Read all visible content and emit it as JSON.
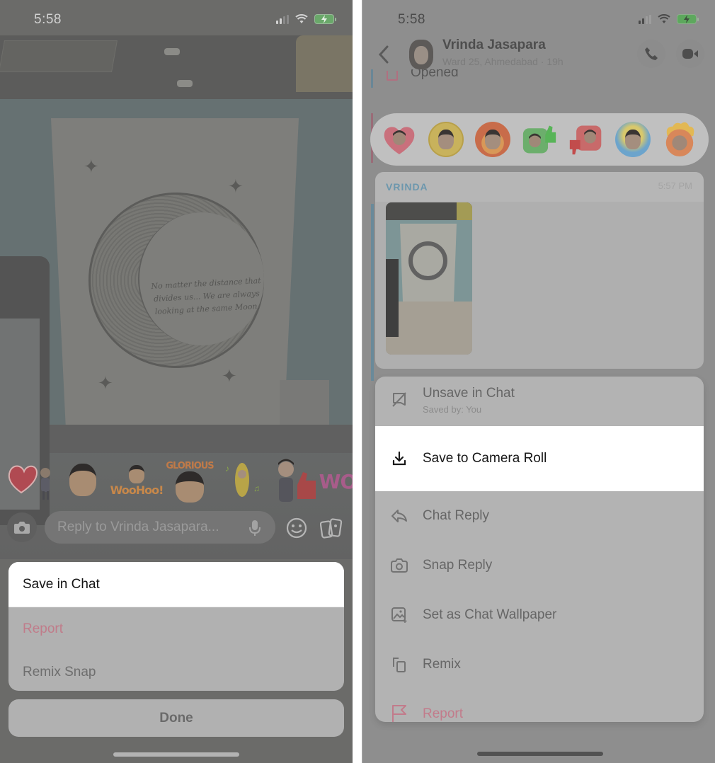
{
  "left_screen": {
    "status_bar": {
      "time": "5:58"
    },
    "photo": {
      "poster_quote": "No matter the distance that divides us... We are always looking at the same Moon."
    },
    "stickers": [
      {
        "name": "heart-hug-sticker",
        "text": ""
      },
      {
        "name": "laughing-bitmoji-sticker",
        "text": ""
      },
      {
        "name": "woohoo-sticker",
        "text": "WooHoo!"
      },
      {
        "name": "glorious-sticker",
        "text": "GLORIOUS"
      },
      {
        "name": "banana-sticker",
        "text": ""
      },
      {
        "name": "thumbs-up-sticker",
        "text": ""
      },
      {
        "name": "wow-sticker",
        "text": "WO"
      }
    ],
    "composer": {
      "placeholder": "Reply to Vrinda Jasapara..."
    },
    "action_sheet": {
      "items": [
        {
          "label": "Save in Chat",
          "highlighted": true
        },
        {
          "label": "Report",
          "danger": true
        },
        {
          "label": "Remix Snap"
        }
      ],
      "done_label": "Done"
    }
  },
  "right_screen": {
    "status_bar": {
      "time": "5:58"
    },
    "header": {
      "contact_name": "Vrinda Jasapara",
      "subtitle": "Ward 25, Ahmedabad · 19h"
    },
    "previous_status": "Opened",
    "reactions": [
      {
        "name": "love-reaction",
        "color": "#d96a7c"
      },
      {
        "name": "laugh-cry-reaction",
        "color": "#e0c04a"
      },
      {
        "name": "fire-reaction",
        "color": "#e07838"
      },
      {
        "name": "thumbs-up-reaction",
        "color": "#58b458"
      },
      {
        "name": "thumbs-down-reaction",
        "color": "#d65a5a"
      },
      {
        "name": "sad-reaction",
        "color": "#5aa0d8"
      },
      {
        "name": "mind-blown-reaction",
        "color": "#e8a838"
      }
    ],
    "message": {
      "sender": "VRINDA",
      "time": "5:57 PM"
    },
    "context_menu": {
      "items": [
        {
          "label": "Unsave in Chat",
          "sublabel": "Saved by: You",
          "icon": "unsave-icon"
        },
        {
          "label": "Save to Camera Roll",
          "icon": "download-icon",
          "highlighted": true
        },
        {
          "label": "Chat Reply",
          "icon": "chat-reply-icon"
        },
        {
          "label": "Snap Reply",
          "icon": "camera-icon"
        },
        {
          "label": "Set as Chat Wallpaper",
          "icon": "wallpaper-icon"
        },
        {
          "label": "Remix",
          "icon": "remix-icon"
        },
        {
          "label": "Report",
          "icon": "flag-icon",
          "danger": true
        }
      ]
    }
  },
  "colors": {
    "sender_accent": "#6c97ad",
    "danger_text": "#c27b8b",
    "highlight_bg": "#ffffff",
    "dim_overlay": "#8e8e8e"
  }
}
